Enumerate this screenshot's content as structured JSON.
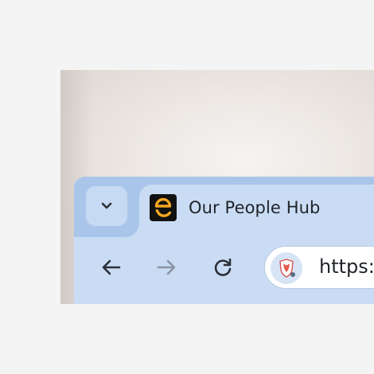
{
  "browser": {
    "tab_title": "Our People Hub",
    "url": "https:",
    "favicon": "letter-e-smile-logo",
    "colors": {
      "tab_strip": "#a9c6ea",
      "toolbar": "#c9dcf4",
      "favicon_accent": "#f5a623"
    }
  },
  "toolbar": {
    "icons": [
      "chevron-down-icon",
      "back-arrow-icon",
      "forward-arrow-icon",
      "reload-icon",
      "brave-shield-icon"
    ]
  }
}
